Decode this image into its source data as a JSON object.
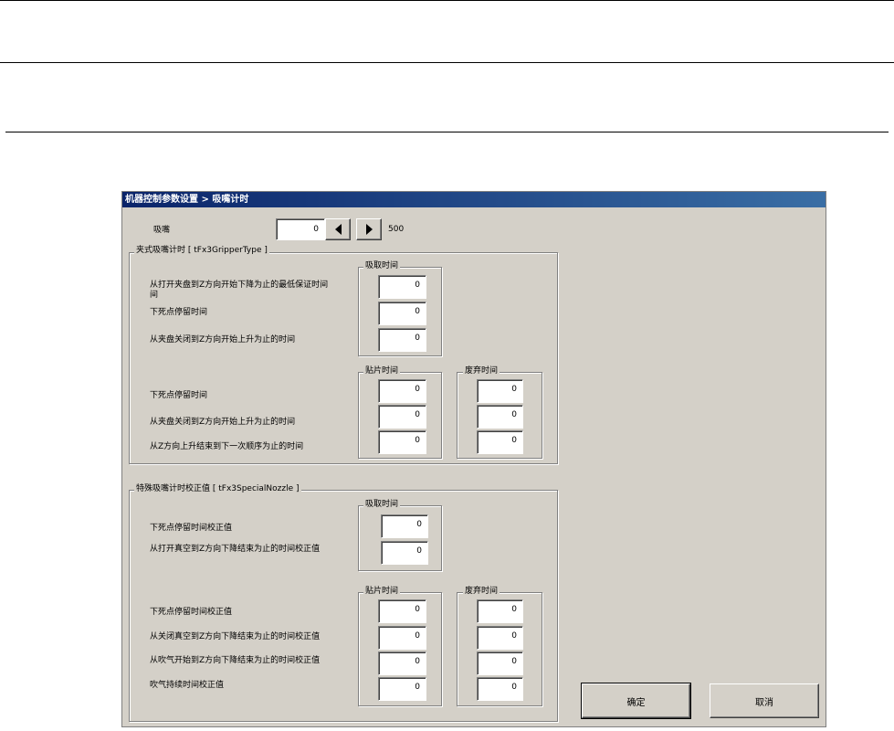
{
  "window": {
    "title": "机器控制参数设置 > 吸嘴计时"
  },
  "nozzle": {
    "label": "吸嘴",
    "value": "0",
    "max": "500"
  },
  "gripper": {
    "title": "夹式吸嘴计时 [ tFx3GripperType ]",
    "pickup_title": "吸取时间",
    "pickup_rows": [
      {
        "label": "从打开夹盘到Z方向开始下降为止的最低保证时间",
        "value": "0"
      },
      {
        "label": "下死点停留时间",
        "value": "0"
      },
      {
        "label": "从夹盘关闭到Z方向开始上升为止的时间",
        "value": "0"
      }
    ],
    "place_title": "贴片时间",
    "discard_title": "废弃时间",
    "place_rows": [
      {
        "label": "下死点停留时间",
        "place": "0",
        "discard": "0"
      },
      {
        "label": "从夹盘关闭到Z方向开始上升为止的时间",
        "place": "0",
        "discard": "0"
      },
      {
        "label": "从Z方向上升结束到下一次顺序为止的时间",
        "place": "0",
        "discard": "0"
      }
    ]
  },
  "special": {
    "title": "特殊吸嘴计时校正值 [ tFx3SpecialNozzle ]",
    "pickup_title": "吸取时间",
    "pickup_rows": [
      {
        "label": "下死点停留时间校正值",
        "value": "0"
      },
      {
        "label": "从打开真空到Z方向下降结束为止的时间校正值",
        "value": "0"
      }
    ],
    "place_title": "贴片时间",
    "discard_title": "废弃时间",
    "place_rows": [
      {
        "label": "下死点停留时间校正值",
        "place": "0",
        "discard": "0"
      },
      {
        "label": "从关闭真空到Z方向下降结束为止的时间校正值",
        "place": "0",
        "discard": "0"
      },
      {
        "label": "从吹气开始到Z方向下降结束为止的时间校正值",
        "place": "0",
        "discard": "0"
      },
      {
        "label": "吹气持续时间校正值",
        "place": "0",
        "discard": "0"
      }
    ]
  },
  "buttons": {
    "ok": "确定",
    "cancel": "取消"
  },
  "icons": {
    "decrement": "triangle-left-icon",
    "increment": "triangle-right-icon"
  },
  "colors": {
    "titlebar": "#0a246a",
    "dialog_bg": "#d4d0c8"
  }
}
